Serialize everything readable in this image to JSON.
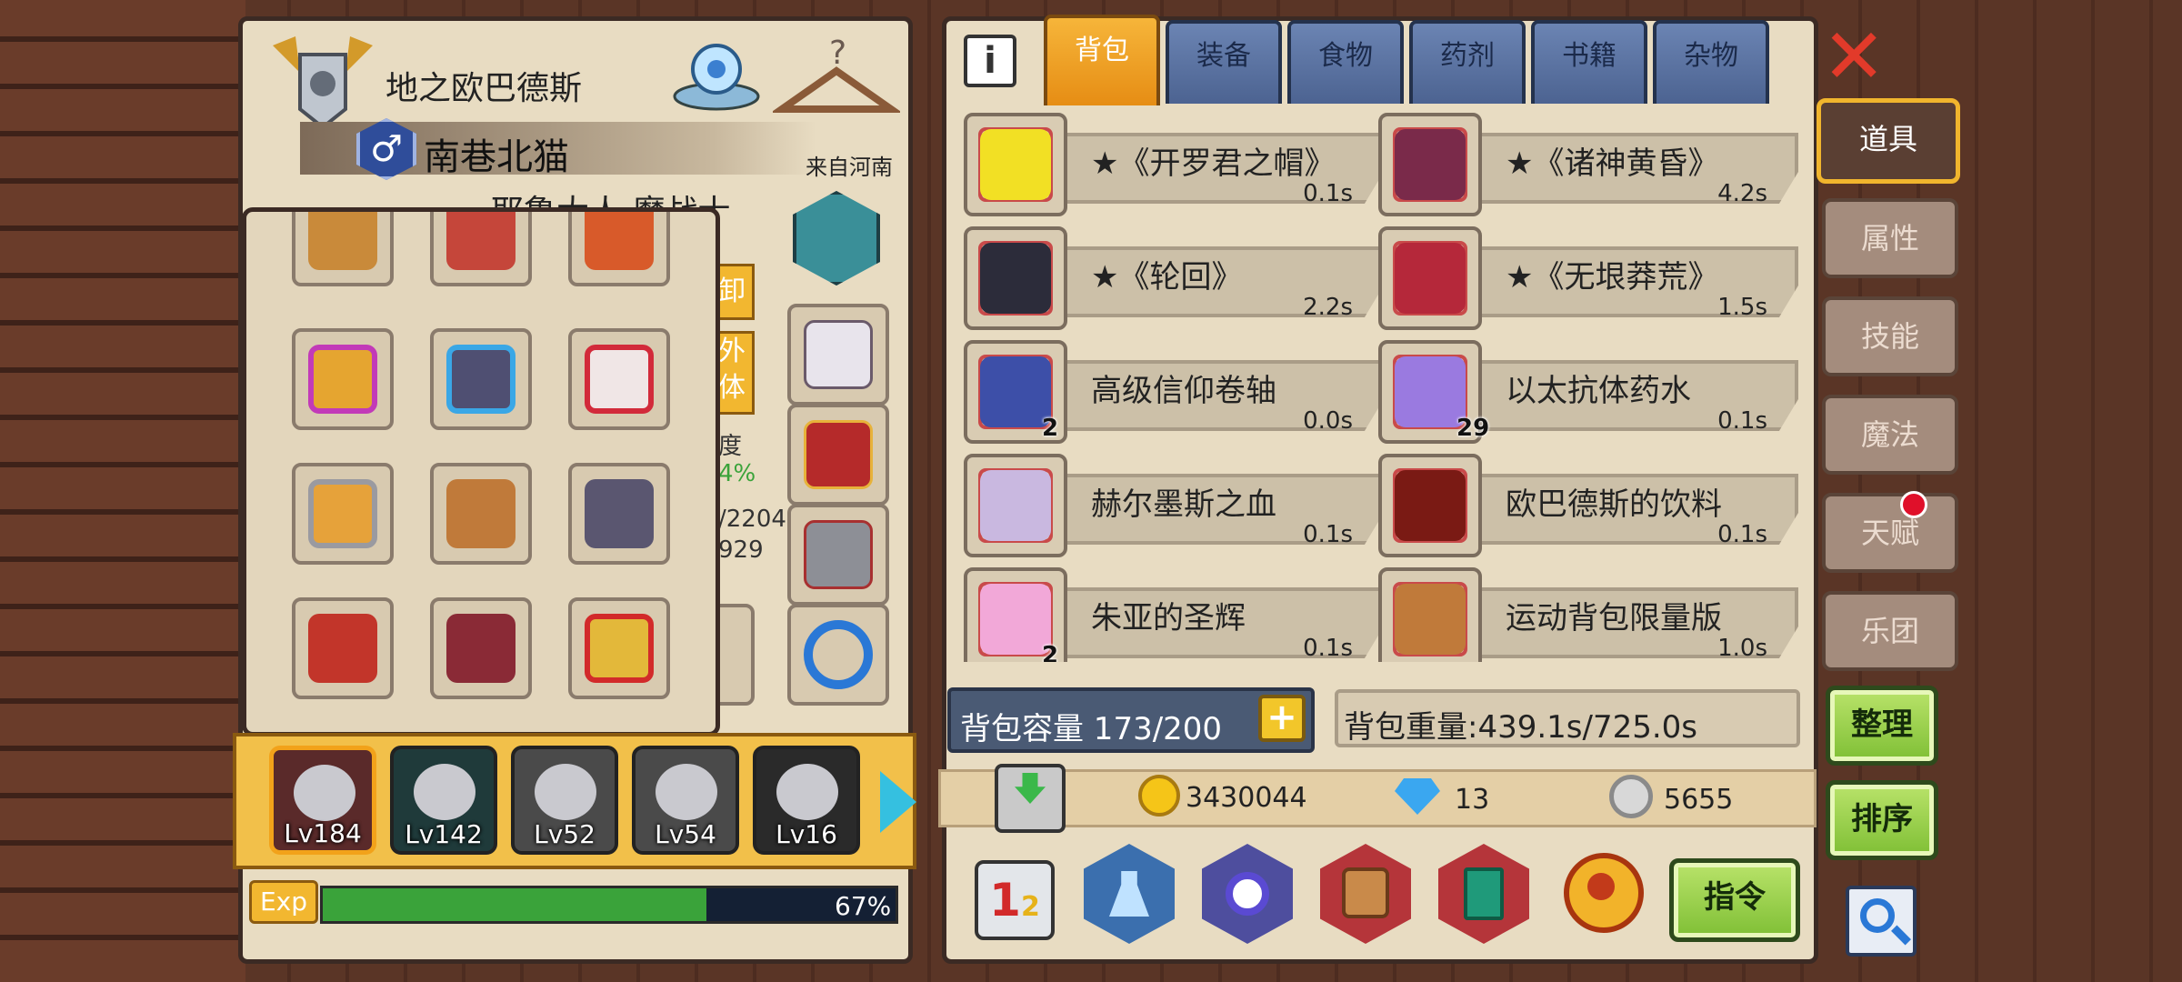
{
  "character": {
    "title": "地之欧巴德斯",
    "name": "南巷北猫",
    "origin": "来自河南",
    "class_partial": "耶鲁大人 魔战士",
    "obscured": {
      "unload": "卸",
      "outer": "外",
      "body": "体",
      "speed": "度",
      "percent": "4%",
      "val1": "/2204",
      "val2": "929"
    }
  },
  "party": [
    {
      "level": "Lv184",
      "selected": true
    },
    {
      "level": "Lv142",
      "selected": false
    },
    {
      "level": "Lv52",
      "selected": false
    },
    {
      "level": "Lv54",
      "selected": false
    },
    {
      "level": "Lv16",
      "selected": false
    }
  ],
  "exp": {
    "label": "Exp",
    "percent_text": "67%",
    "percent": 67
  },
  "tabs": [
    "背包",
    "装备",
    "食物",
    "药剂",
    "书籍",
    "杂物"
  ],
  "active_tab": "背包",
  "items": [
    {
      "name": "★《开罗君之帽》",
      "time": "0.1s",
      "count": "",
      "icon": "yellow-cube-hat-icon"
    },
    {
      "name": "★《诸神黄昏》",
      "time": "4.2s",
      "count": "",
      "icon": "purple-blade-icon"
    },
    {
      "name": "★《轮回》",
      "time": "2.2s",
      "count": "",
      "icon": "dark-claw-icon"
    },
    {
      "name": "★《无垠莽荒》",
      "time": "1.5s",
      "count": "",
      "icon": "red-belt-icon"
    },
    {
      "name": "高级信仰卷轴",
      "time": "0.0s",
      "count": "2",
      "icon": "scroll-pouch-icon"
    },
    {
      "name": "以太抗体药水",
      "time": "0.1s",
      "count": "29",
      "icon": "purple-potion-icon"
    },
    {
      "name": "赫尔墨斯之血",
      "time": "0.1s",
      "count": "",
      "icon": "orb-flask-icon"
    },
    {
      "name": "欧巴德斯的饮料",
      "time": "0.1s",
      "count": "",
      "icon": "cola-bottle-icon"
    },
    {
      "name": "朱亚的圣辉",
      "time": "0.1s",
      "count": "2",
      "icon": "pink-flask-icon"
    },
    {
      "name": "运动背包限量版",
      "time": "1.0s",
      "count": "",
      "icon": "brown-backpack-icon"
    }
  ],
  "capacity": {
    "label": "背包容量 173/200"
  },
  "weight": {
    "label": "背包重量:439.1s/725.0s"
  },
  "currency": {
    "gold": "3430044",
    "gem": "13",
    "silver": "5655"
  },
  "side_tabs": [
    "道具",
    "属性",
    "技能",
    "魔法",
    "天赋",
    "乐团"
  ],
  "side_active": "道具",
  "buttons": {
    "organize": "整理",
    "sort": "排序",
    "command": "指令"
  },
  "colors": {
    "accent": "#f1b52d",
    "exp_fill": "#3aa33a",
    "tab_blue": "#5d76a6",
    "panel": "#e8dcc2"
  }
}
